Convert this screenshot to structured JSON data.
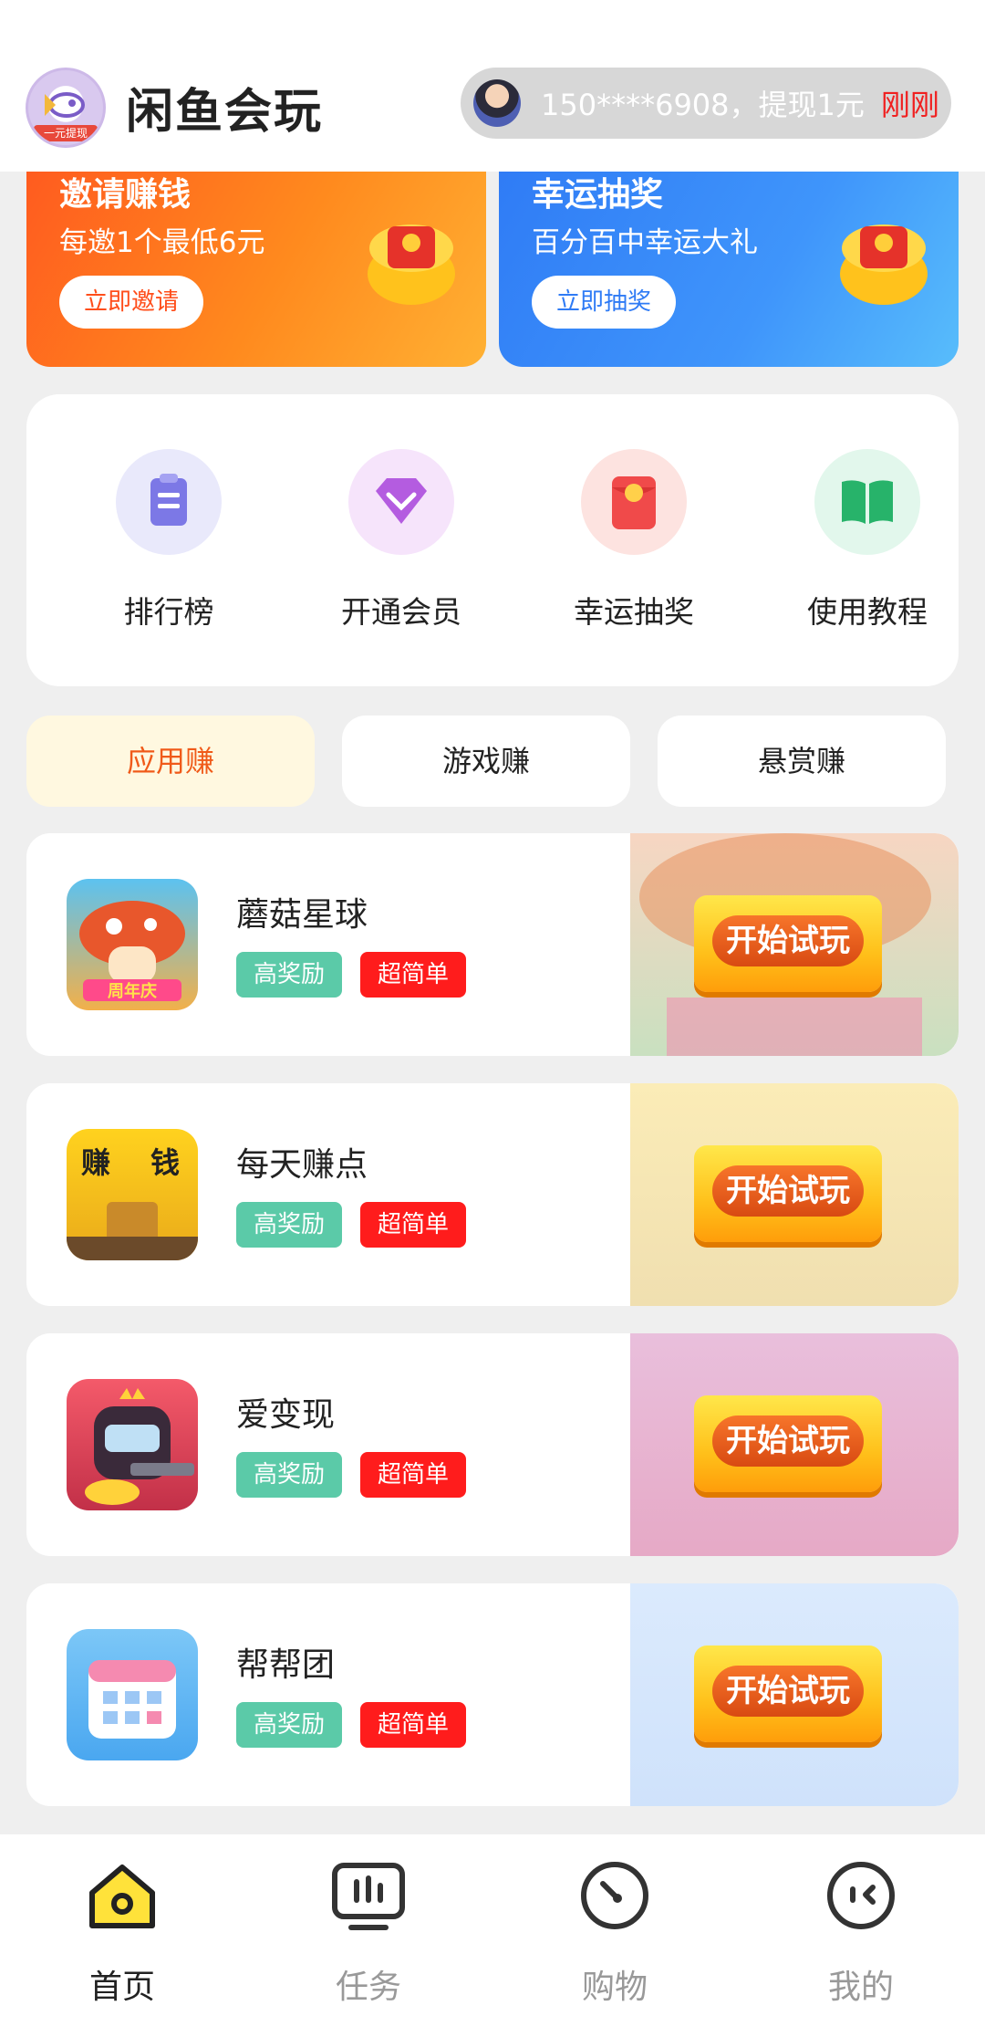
{
  "header": {
    "app_title": "闲鱼会玩",
    "logo_ribbon": "一元提现",
    "ticker_text": "150****6908，提现1元",
    "ticker_time": "刚刚"
  },
  "promos": [
    {
      "title": "邀请赚钱",
      "subtitle": "每邀1个最低6元",
      "button": "立即邀请"
    },
    {
      "title": "幸运抽奖",
      "subtitle": "百分百中幸运大礼",
      "button": "立即抽奖"
    }
  ],
  "quick_menu": [
    {
      "label": "排行榜",
      "icon": "clipboard-icon"
    },
    {
      "label": "开通会员",
      "icon": "diamond-icon"
    },
    {
      "label": "幸运抽奖",
      "icon": "red-envelope-icon"
    },
    {
      "label": "使用教程",
      "icon": "book-icon"
    }
  ],
  "tabs": [
    {
      "label": "应用赚",
      "active": true
    },
    {
      "label": "游戏赚",
      "active": false
    },
    {
      "label": "悬赏赚",
      "active": false
    }
  ],
  "tasks": [
    {
      "name": "蘑菇星球",
      "tag1": "高奖励",
      "tag2": "超简单",
      "action": "开始试玩"
    },
    {
      "name": "每天赚点",
      "tag1": "高奖励",
      "tag2": "超简单",
      "action": "开始试玩"
    },
    {
      "name": "爱变现",
      "tag1": "高奖励",
      "tag2": "超简单",
      "action": "开始试玩"
    },
    {
      "name": "帮帮团",
      "tag1": "高奖励",
      "tag2": "超简单",
      "action": "开始试玩"
    }
  ],
  "task_art_text": [
    "周年庆",
    "赚",
    "钱"
  ],
  "bottom_nav": [
    {
      "label": "首页",
      "active": true,
      "icon": "home-icon"
    },
    {
      "label": "任务",
      "active": false,
      "icon": "task-icon"
    },
    {
      "label": "购物",
      "active": false,
      "icon": "shopping-icon"
    },
    {
      "label": "我的",
      "active": false,
      "icon": "profile-icon"
    }
  ],
  "colors": {
    "accent_orange": "#f05a19",
    "tag_green": "#5bcaa8",
    "tag_red": "#ff1c1c",
    "nav_active_yellow": "#ffe23a"
  }
}
